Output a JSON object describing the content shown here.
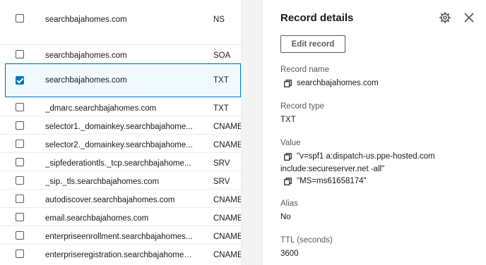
{
  "records": [
    {
      "name": "searchbajahomes.com",
      "type": "NS",
      "checked": false,
      "selected": false
    },
    {
      "name": "searchbajahomes.com",
      "type": "SOA",
      "checked": false,
      "selected": false
    },
    {
      "name": "searchbajahomes.com",
      "type": "TXT",
      "checked": true,
      "selected": true
    },
    {
      "name": "_dmarc.searchbajahomes.com",
      "type": "TXT",
      "checked": false,
      "selected": false
    },
    {
      "name": "selector1._domainkey.searchbajahome...",
      "type": "CNAME",
      "checked": false,
      "selected": false
    },
    {
      "name": "selector2._domainkey.searchbajahome...",
      "type": "CNAME",
      "checked": false,
      "selected": false
    },
    {
      "name": "_sipfederationtls._tcp.searchbajahome...",
      "type": "SRV",
      "checked": false,
      "selected": false
    },
    {
      "name": "_sip._tls.searchbajahomes.com",
      "type": "SRV",
      "checked": false,
      "selected": false
    },
    {
      "name": "autodiscover.searchbajahomes.com",
      "type": "CNAME",
      "checked": false,
      "selected": false
    },
    {
      "name": "email.searchbajahomes.com",
      "type": "CNAME",
      "checked": false,
      "selected": false
    },
    {
      "name": "enterpriseenrollment.searchbajahomes...",
      "type": "CNAME",
      "checked": false,
      "selected": false
    },
    {
      "name": "enterpriseregistration.searchbajahomes...",
      "type": "CNAME",
      "checked": false,
      "selected": false
    }
  ],
  "details": {
    "title": "Record details",
    "edit_button": "Edit record",
    "record_name_label": "Record name",
    "record_name": "searchbajahomes.com",
    "record_type_label": "Record type",
    "record_type": "TXT",
    "value_label": "Value",
    "value_line1": "\"v=spf1 a:dispatch-us.ppe-hosted.com",
    "value_line2": "include:secureserver.net -all\"",
    "value_line3": "\"MS=ms61658174\"",
    "alias_label": "Alias",
    "alias": "No",
    "ttl_label": "TTL (seconds)",
    "ttl": "3600"
  },
  "icons": {
    "settings": "gear-icon",
    "close": "close-icon",
    "copy": "copy-icon",
    "resize": "resize-handle-icon"
  }
}
